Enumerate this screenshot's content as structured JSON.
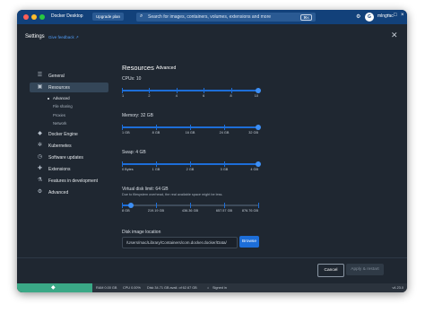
{
  "titlebar": {
    "app_name": "Docker Desktop",
    "upgrade": "Upgrade plan",
    "search_placeholder": "Search for images, containers, volumes, extensions and more",
    "search_shortcut": "⌘K",
    "user": "mlngrac",
    "avatar_letter": "G"
  },
  "header": {
    "title": "Settings",
    "feedback": "Give feedback ↗"
  },
  "sidebar": {
    "items": [
      {
        "label": "General",
        "icon": "sliders-icon"
      },
      {
        "label": "Resources",
        "icon": "resources-icon"
      },
      {
        "label": "Docker Engine",
        "icon": "whale-icon"
      },
      {
        "label": "Kubernetes",
        "icon": "kubernetes-icon"
      },
      {
        "label": "Software updates",
        "icon": "clock-icon"
      },
      {
        "label": "Extensions",
        "icon": "puzzle-icon"
      },
      {
        "label": "Features in development",
        "icon": "flask-icon"
      },
      {
        "label": "Advanced",
        "icon": "gear-icon"
      }
    ],
    "sub_items": [
      "Advanced",
      "File sharing",
      "Proxies",
      "Network"
    ]
  },
  "panel": {
    "title": "Resources",
    "tab": "Advanced",
    "cpus": {
      "label": "CPUs: 10",
      "ticks": [
        "1",
        "2",
        "4",
        "6",
        "8",
        "10"
      ],
      "value_fraction": 1.0
    },
    "memory": {
      "label": "Memory: 32 GB",
      "ticks": [
        "1 GB",
        "8 GB",
        "16 GB",
        "24 GB",
        "32 GB"
      ],
      "value_fraction": 1.0
    },
    "swap": {
      "label": "Swap: 4 GB",
      "ticks": [
        "0 Bytes",
        "1 GB",
        "2 GB",
        "3 GB",
        "4 GB"
      ],
      "value_fraction": 1.0
    },
    "disk": {
      "label": "Virtual disk limit: 64 GB",
      "note": "Due to filesystem overhead, the real available space might be less.",
      "ticks": [
        "8 GB",
        "219.19 GB",
        "436.36 GB",
        "657.57 GB",
        "876.76 GB"
      ],
      "value_fraction": 0.064
    },
    "disk_image": {
      "label": "Disk image location",
      "value": "/Users/mac/Library/Containers/com.docker.docker/Data/",
      "browse": "Browse"
    }
  },
  "footer": {
    "cancel": "Cancel",
    "apply": "Apply & restart"
  },
  "statusbar": {
    "ram": "RAM 0.00 GB",
    "cpu": "CPU 0.00%",
    "disk": "Disk 34.71 GB avail. of 62.67 GB",
    "signin": "Signed in",
    "version": "v4.23.0"
  },
  "colors": {
    "accent": "#1d6ed8",
    "titlebar": "#12417a",
    "background": "#1f2731",
    "whale_block": "#3aa886"
  }
}
